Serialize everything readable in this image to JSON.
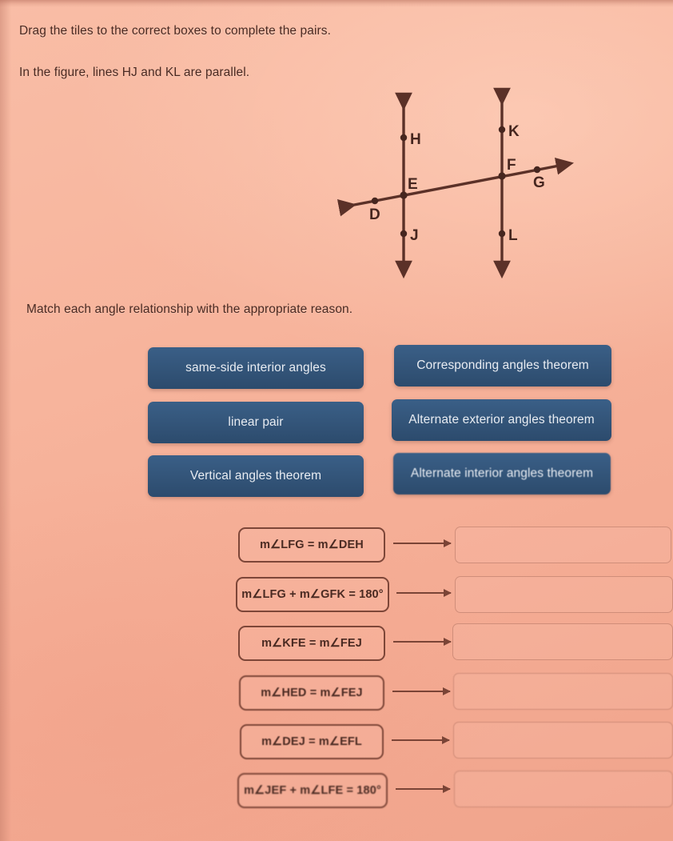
{
  "instructions": {
    "drag": "Drag the tiles to the correct boxes to complete the pairs.",
    "figure_note": "In the figure, lines HJ and KL are parallel.",
    "match": "Match each angle relationship with the appropriate reason."
  },
  "figure": {
    "points": [
      {
        "id": "H",
        "label": "H"
      },
      {
        "id": "K",
        "label": "K"
      },
      {
        "id": "F",
        "label": "F"
      },
      {
        "id": "G",
        "label": "G"
      },
      {
        "id": "E",
        "label": "E"
      },
      {
        "id": "D",
        "label": "D"
      },
      {
        "id": "J",
        "label": "J"
      },
      {
        "id": "L",
        "label": "L"
      }
    ],
    "lines": [
      "HJ",
      "KL",
      "DG"
    ],
    "stroke_color": "#5b3128"
  },
  "tiles": [
    {
      "id": "same-side",
      "label": "same-side interior angles"
    },
    {
      "id": "corresponding",
      "label": "Corresponding angles theorem"
    },
    {
      "id": "linear-pair",
      "label": "linear pair"
    },
    {
      "id": "alt-exterior",
      "label": "Alternate exterior angles theorem"
    },
    {
      "id": "vertical",
      "label": "Vertical angles theorem"
    },
    {
      "id": "alt-interior",
      "label": "Alternate interior angles theorem"
    }
  ],
  "rows": [
    {
      "equation": "m∠LFG = m∠DEH",
      "answer": ""
    },
    {
      "equation": "m∠LFG + m∠GFK = 180°",
      "answer": ""
    },
    {
      "equation": "m∠KFE = m∠FEJ",
      "answer": ""
    },
    {
      "equation": "m∠HED = m∠FEJ",
      "answer": ""
    },
    {
      "equation": "m∠DEJ = m∠EFL",
      "answer": ""
    },
    {
      "equation": "m∠JEF + m∠LFE = 180°",
      "answer": ""
    }
  ],
  "colors": {
    "page_background": "#f7b49c",
    "tile_background": "#33587f",
    "tile_text": "#e8ecf2",
    "ink": "#4a2a22",
    "figure_stroke": "#5b3128"
  }
}
